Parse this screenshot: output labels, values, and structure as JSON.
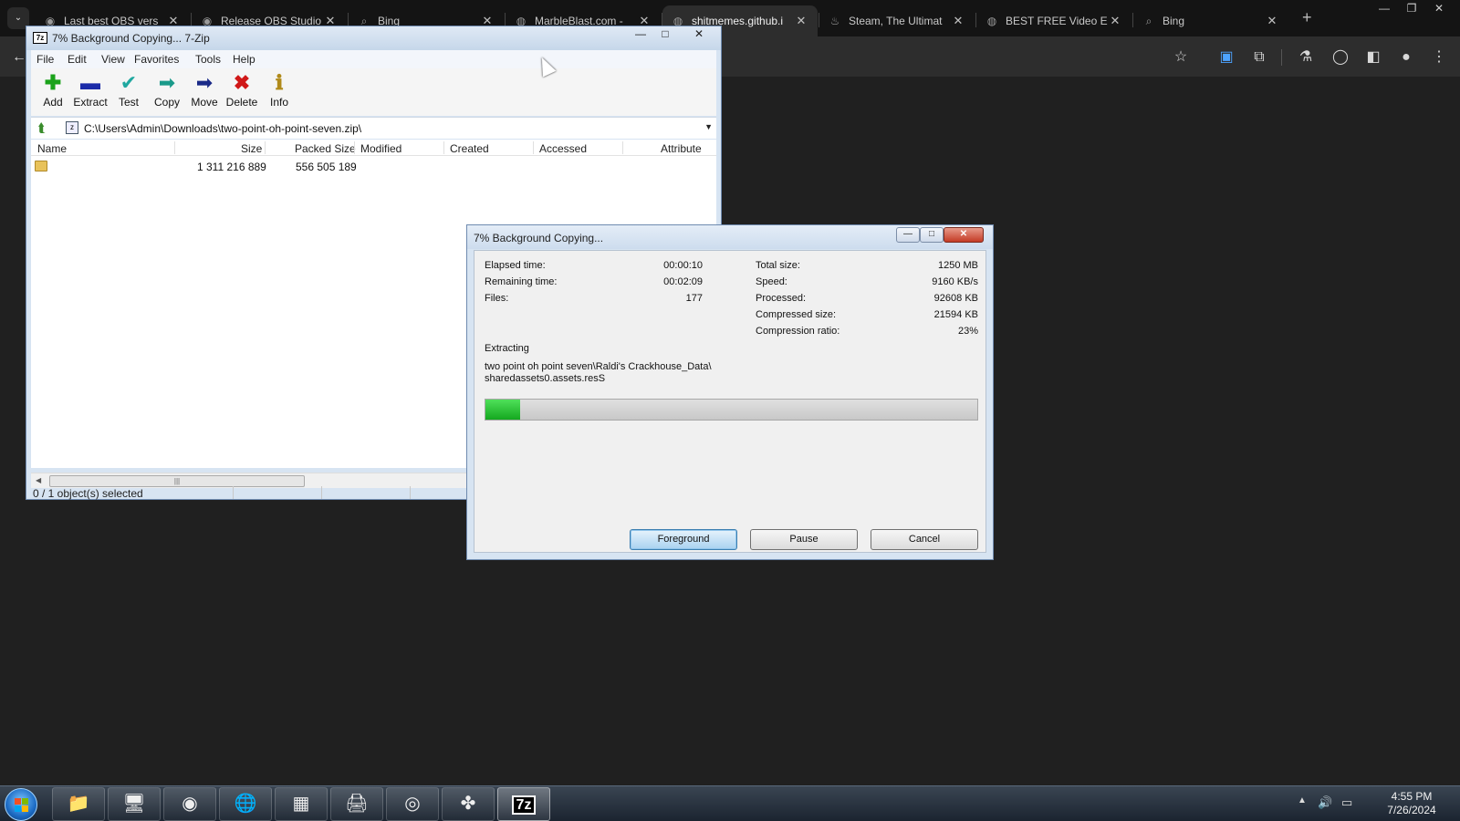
{
  "browser": {
    "tabs": [
      {
        "title": "Last best OBS vers",
        "icon": "github-icon"
      },
      {
        "title": "Release OBS Studio",
        "icon": "github-icon"
      },
      {
        "title": "Bing",
        "icon": "search-icon"
      },
      {
        "title": "MarbleBlast.com -",
        "icon": "globe-icon"
      },
      {
        "title": "shitmemes.github.i",
        "icon": "globe-icon",
        "active": true
      },
      {
        "title": "Steam, The Ultimat",
        "icon": "steam-icon"
      },
      {
        "title": "BEST FREE Video E",
        "icon": "globe-icon"
      },
      {
        "title": "Bing",
        "icon": "search-icon"
      }
    ],
    "new_tab_symbol": "+"
  },
  "zip_window": {
    "title": "7% Background Copying... 7-Zip",
    "menu": [
      "File",
      "Edit",
      "View",
      "Favorites",
      "Tools",
      "Help"
    ],
    "toolbar": [
      {
        "label": "Add",
        "icon": "plus-icon",
        "color": "#1aa21a"
      },
      {
        "label": "Extract",
        "icon": "minus-icon",
        "color": "#1a2aa8"
      },
      {
        "label": "Test",
        "icon": "check-icon",
        "color": "#20a8a0"
      },
      {
        "label": "Copy",
        "icon": "copy-arrow-icon",
        "color": "#1a9a8a"
      },
      {
        "label": "Move",
        "icon": "move-arrow-icon",
        "color": "#1a2a88"
      },
      {
        "label": "Delete",
        "icon": "delete-x-icon",
        "color": "#d01818"
      },
      {
        "label": "Info",
        "icon": "info-icon",
        "color": "#b08a1a"
      }
    ],
    "path": "C:\\Users\\Admin\\Downloads\\two-point-oh-point-seven.zip\\",
    "columns": [
      "Name",
      "Size",
      "Packed Size",
      "Modified",
      "Created",
      "Accessed",
      "Attribute"
    ],
    "rows": [
      {
        "name": "",
        "size": "1 311 216 889",
        "packed": "556 505 189"
      }
    ],
    "status": "0 / 1 object(s) selected"
  },
  "progress_dialog": {
    "title": "7% Background Copying...",
    "left_stats": [
      {
        "label": "Elapsed time:",
        "value": "00:00:10"
      },
      {
        "label": "Remaining time:",
        "value": "00:02:09"
      },
      {
        "label": "Files:",
        "value": "177"
      }
    ],
    "right_stats": [
      {
        "label": "Total size:",
        "value": "1250 MB"
      },
      {
        "label": "Speed:",
        "value": "9160 KB/s"
      },
      {
        "label": "Processed:",
        "value": "92608 KB"
      },
      {
        "label": "Compressed size:",
        "value": "21594 KB"
      },
      {
        "label": "Compression ratio:",
        "value": "23%"
      }
    ],
    "operation": "Extracting",
    "current_file_line1": "two point oh point seven\\Raldi's Crackhouse_Data\\",
    "current_file_line2": "sharedassets0.assets.resS",
    "progress_percent": 7,
    "buttons": {
      "foreground": "Foreground",
      "pause": "Pause",
      "cancel": "Cancel"
    }
  },
  "taskbar": {
    "items": [
      {
        "name": "explorer",
        "icon": "folder-icon"
      },
      {
        "name": "computer",
        "icon": "computer-icon"
      },
      {
        "name": "chrome",
        "icon": "chrome-icon"
      },
      {
        "name": "globe-app",
        "icon": "globe-icon"
      },
      {
        "name": "app-tiles",
        "icon": "tiles-icon"
      },
      {
        "name": "print-app",
        "icon": "printer-icon"
      },
      {
        "name": "obs",
        "icon": "obs-icon"
      },
      {
        "name": "gamepad-app",
        "icon": "gamepad-icon"
      },
      {
        "name": "7zip",
        "icon": "7zip-icon",
        "label": "7z",
        "active": true
      }
    ],
    "clock_time": "4:55 PM",
    "clock_date": "7/26/2024"
  }
}
